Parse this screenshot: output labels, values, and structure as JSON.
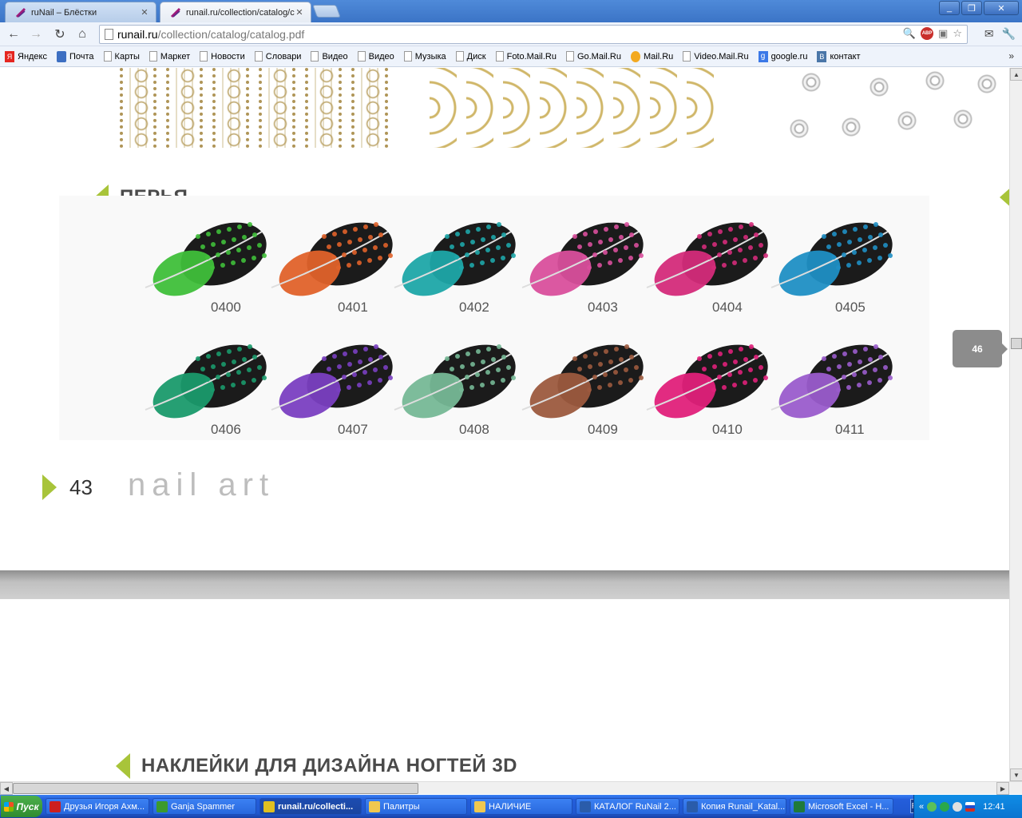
{
  "browser": {
    "tabs": [
      {
        "title": "ruNail – Блёстки",
        "active": false
      },
      {
        "title": "runail.ru/collection/catalog/c",
        "active": true
      }
    ],
    "url_domain": "runail.ru",
    "url_path": "/collection/catalog/catalog.pdf",
    "bookmarks": [
      "Яндекс",
      "Почта",
      "Карты",
      "Маркет",
      "Новости",
      "Словари",
      "Видео",
      "Видео",
      "Музыка",
      "Диск",
      "Foto.Mail.Ru",
      "Go.Mail.Ru",
      "Mail.Ru",
      "Video.Mail.Ru",
      "google.ru",
      "контакт"
    ],
    "bookmark_more": "»",
    "abp_label": "ABP"
  },
  "pdf": {
    "section_feathers": "ПЕРЬЯ",
    "feathers": [
      {
        "code": "0400",
        "color": "#3fbf3a"
      },
      {
        "code": "0401",
        "color": "#e0622a"
      },
      {
        "code": "0402",
        "color": "#1ea6a8"
      },
      {
        "code": "0403",
        "color": "#d94f9c"
      },
      {
        "code": "0404",
        "color": "#d42b7a"
      },
      {
        "code": "0405",
        "color": "#1f8fc4"
      },
      {
        "code": "0406",
        "color": "#1a9a6c"
      },
      {
        "code": "0407",
        "color": "#7a3fc1"
      },
      {
        "code": "0408",
        "color": "#76b896"
      },
      {
        "code": "0409",
        "color": "#9c5a3e"
      },
      {
        "code": "0410",
        "color": "#e0207a"
      },
      {
        "code": "0411",
        "color": "#9a5ccc"
      }
    ],
    "page_number": "43",
    "footer_title": "nail art",
    "page_badge": "46",
    "section_stickers": "НАКЛЕЙКИ ДЛЯ ДИЗАЙНА НОГТЕЙ 3D",
    "accent_color": "#a8c43a"
  },
  "taskbar": {
    "start_label": "Пуск",
    "items": [
      {
        "label": "Друзья Игоря Ахм...",
        "icon_color": "#cc1f1f",
        "active": false
      },
      {
        "label": "Ganja Spammer",
        "icon_color": "#3c9a2e",
        "active": false
      },
      {
        "label": "runail.ru/collecti...",
        "icon_color": "#e0c020",
        "active": true
      },
      {
        "label": "Палитры",
        "icon_color": "#f0c850",
        "active": false
      },
      {
        "label": "НАЛИЧИЕ",
        "icon_color": "#f0c850",
        "active": false
      },
      {
        "label": "КАТАЛОГ RuNail 2...",
        "icon_color": "#2a5caa",
        "active": false
      },
      {
        "label": "Копия Runail_Katal...",
        "icon_color": "#2a5caa",
        "active": false
      },
      {
        "label": "Microsoft Excel - Н...",
        "icon_color": "#1f7a3a",
        "active": false
      }
    ],
    "lang": "RU",
    "tray_chevron": "«",
    "clock": "12:41"
  }
}
